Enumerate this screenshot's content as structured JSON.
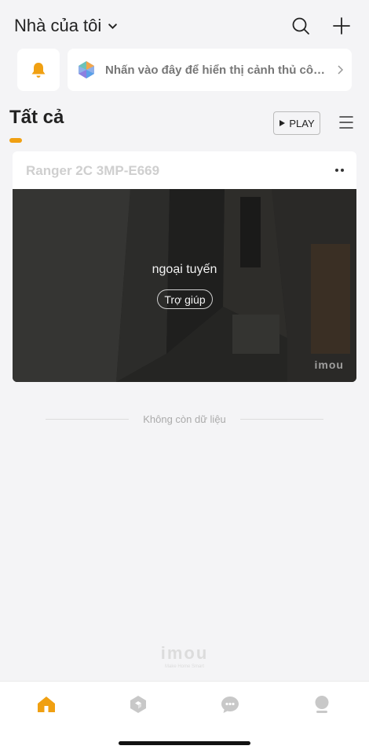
{
  "header": {
    "home_title": "Nhà của tôi",
    "icons": [
      "search-icon",
      "plus-icon"
    ]
  },
  "notification": {
    "bell_icon": "bell-icon",
    "scene_text": "Nhấn vào đây để hiển thị cảnh thủ công"
  },
  "section": {
    "tab_label": "Tất cả",
    "play_label": "PLAY"
  },
  "device": {
    "name": "Ranger 2C 3MP-E669",
    "status": "ngoại tuyến",
    "help_label": "Trợ giúp",
    "watermark": "imou"
  },
  "list_end_text": "Không còn dữ liệu",
  "footer_logo": {
    "brand": "imou",
    "tagline": "Make Home Smart"
  },
  "tabbar": {
    "tabs": [
      "home-icon",
      "scene-icon",
      "message-icon",
      "profile-icon"
    ],
    "active": "home-icon"
  },
  "colors": {
    "accent": "#f0a012",
    "background": "#f4f4f6",
    "inactive_icon": "#c8c8c8"
  }
}
